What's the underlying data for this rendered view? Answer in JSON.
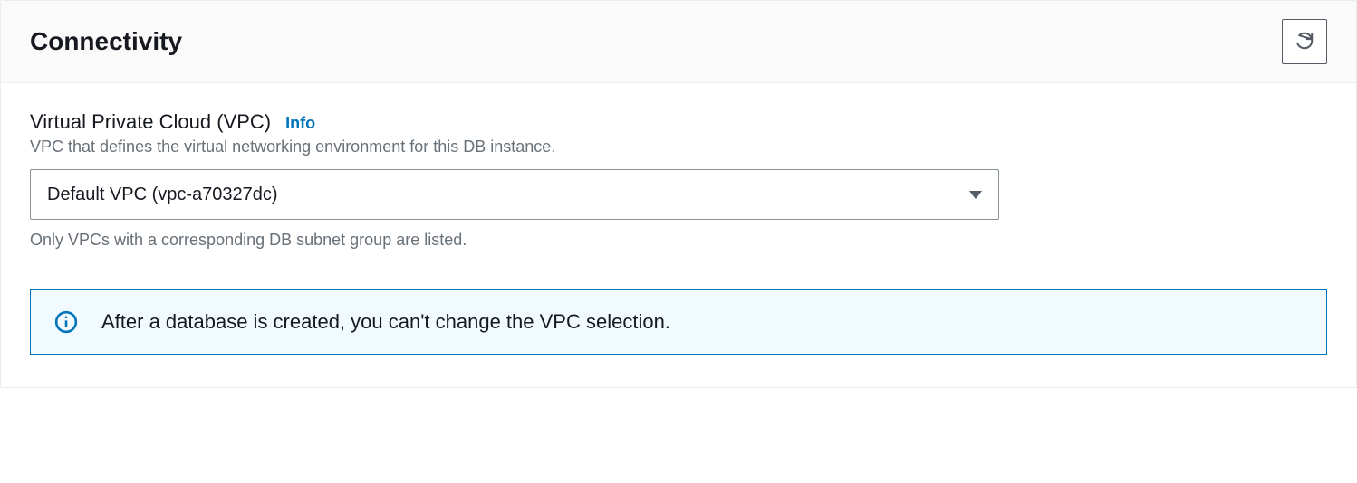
{
  "header": {
    "title": "Connectivity"
  },
  "vpc": {
    "label": "Virtual Private Cloud (VPC)",
    "info_label": "Info",
    "description": "VPC that defines the virtual networking environment for this DB instance.",
    "selected": "Default VPC (vpc-a70327dc)",
    "hint": "Only VPCs with a corresponding DB subnet group are listed."
  },
  "alert": {
    "message": "After a database is created, you can't change the VPC selection."
  }
}
